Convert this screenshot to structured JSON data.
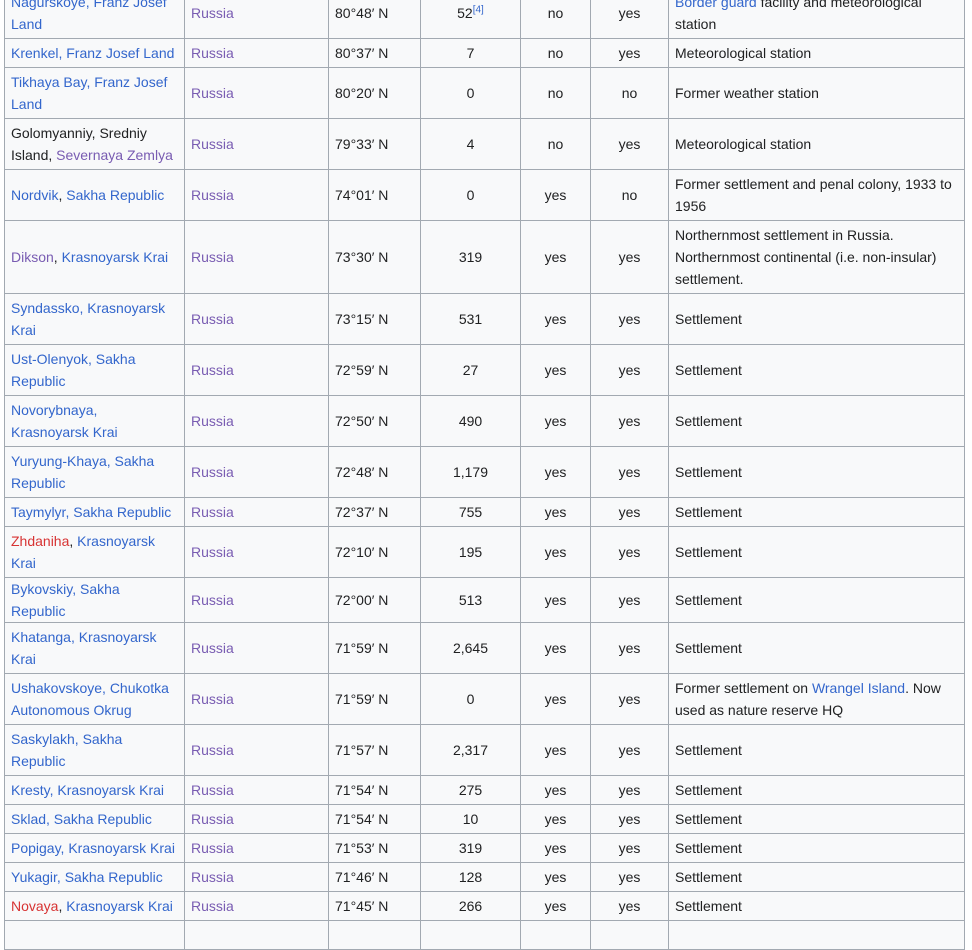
{
  "rows": [
    {
      "place": [
        {
          "t": "Nagurskoye, Franz Josef Land",
          "s": "link"
        }
      ],
      "country": "Russia",
      "lat": "80°48′ N",
      "pop": "52",
      "ref": "[4]",
      "y1": "no",
      "y2": "yes",
      "notes": [
        {
          "t": "Border guard",
          "s": "link"
        },
        {
          "t": " facility and meteorological station",
          "s": "plain"
        }
      ],
      "h": 51
    },
    {
      "place": [
        {
          "t": "Krenkel, Franz Josef Land",
          "s": "link"
        }
      ],
      "country": "Russia",
      "lat": "80°37′ N",
      "pop": "7",
      "y1": "no",
      "y2": "yes",
      "notes": [
        {
          "t": "Meteorological station",
          "s": "plain"
        }
      ],
      "h": 29
    },
    {
      "place": [
        {
          "t": "Tikhaya Bay, Franz Josef Land",
          "s": "link"
        }
      ],
      "country": "Russia",
      "lat": "80°20′ N",
      "pop": "0",
      "y1": "no",
      "y2": "no",
      "notes": [
        {
          "t": "Former weather station",
          "s": "plain"
        }
      ],
      "h": 51
    },
    {
      "place": [
        {
          "t": "Golomyanniy, Sredniy Island",
          "s": "plain"
        },
        {
          "t": ", ",
          "s": "plain"
        },
        {
          "t": "Severnaya Zemlya",
          "s": "visited"
        }
      ],
      "country": "Russia",
      "lat": "79°33′ N",
      "pop": "4",
      "y1": "no",
      "y2": "yes",
      "notes": [
        {
          "t": "Meteorological station",
          "s": "plain"
        }
      ],
      "h": 51
    },
    {
      "place": [
        {
          "t": "Nordvik",
          "s": "link"
        },
        {
          "t": ", ",
          "s": "plain"
        },
        {
          "t": "Sakha Republic",
          "s": "link"
        }
      ],
      "country": "Russia",
      "lat": "74°01′ N",
      "pop": "0",
      "y1": "yes",
      "y2": "no",
      "notes": [
        {
          "t": "Former settlement and penal colony, 1933 to 1956",
          "s": "plain"
        }
      ],
      "h": 51
    },
    {
      "place": [
        {
          "t": "Dikson",
          "s": "visited"
        },
        {
          "t": ", ",
          "s": "plain"
        },
        {
          "t": "Krasnoyarsk Krai",
          "s": "link"
        }
      ],
      "country": "Russia",
      "lat": "73°30′ N",
      "pop": "319",
      "y1": "yes",
      "y2": "yes",
      "notes": [
        {
          "t": "Northernmost settlement in Russia. Northernmost continental (i.e. non-insular) settlement.",
          "s": "plain"
        }
      ],
      "h": 73
    },
    {
      "place": [
        {
          "t": "Syndassko, Krasnoyarsk Krai",
          "s": "link"
        }
      ],
      "country": "Russia",
      "lat": "73°15′ N",
      "pop": "531",
      "y1": "yes",
      "y2": "yes",
      "notes": [
        {
          "t": "Settlement",
          "s": "plain"
        }
      ],
      "h": 51
    },
    {
      "place": [
        {
          "t": "Ust-Olenyok, Sakha Republic",
          "s": "link"
        }
      ],
      "country": "Russia",
      "lat": "72°59′ N",
      "pop": "27",
      "y1": "yes",
      "y2": "yes",
      "notes": [
        {
          "t": "Settlement",
          "s": "plain"
        }
      ],
      "h": 51
    },
    {
      "place": [
        {
          "t": "Novorybnaya, Krasnoyarsk Krai",
          "s": "link"
        }
      ],
      "country": "Russia",
      "lat": "72°50′ N",
      "pop": "490",
      "y1": "yes",
      "y2": "yes",
      "notes": [
        {
          "t": "Settlement",
          "s": "plain"
        }
      ],
      "h": 51
    },
    {
      "place": [
        {
          "t": "Yuryung-Khaya, Sakha Republic",
          "s": "link"
        }
      ],
      "country": "Russia",
      "lat": "72°48′ N",
      "pop": "1,179",
      "y1": "yes",
      "y2": "yes",
      "notes": [
        {
          "t": "Settlement",
          "s": "plain"
        }
      ],
      "h": 51
    },
    {
      "place": [
        {
          "t": "Taymylyr, Sakha Republic",
          "s": "link"
        }
      ],
      "country": "Russia",
      "lat": "72°37′ N",
      "pop": "755",
      "y1": "yes",
      "y2": "yes",
      "notes": [
        {
          "t": "Settlement",
          "s": "plain"
        }
      ],
      "h": 29
    },
    {
      "place": [
        {
          "t": "Zhdaniha",
          "s": "new"
        },
        {
          "t": ", ",
          "s": "plain"
        },
        {
          "t": "Krasnoyarsk Krai",
          "s": "link"
        }
      ],
      "country": "Russia",
      "lat": "72°10′ N",
      "pop": "195",
      "y1": "yes",
      "y2": "yes",
      "notes": [
        {
          "t": "Settlement",
          "s": "plain"
        }
      ],
      "h": 51
    },
    {
      "place": [
        {
          "t": "Bykovskiy, Sakha Republic",
          "s": "link"
        }
      ],
      "country": "Russia",
      "lat": "72°00′ N",
      "pop": "513",
      "y1": "yes",
      "y2": "yes",
      "notes": [
        {
          "t": "Settlement",
          "s": "plain"
        }
      ],
      "h": 29
    },
    {
      "place": [
        {
          "t": "Khatanga, Krasnoyarsk Krai",
          "s": "link"
        }
      ],
      "country": "Russia",
      "lat": "71°59′ N",
      "pop": "2,645",
      "y1": "yes",
      "y2": "yes",
      "notes": [
        {
          "t": "Settlement",
          "s": "plain"
        }
      ],
      "h": 51
    },
    {
      "place": [
        {
          "t": "Ushakovskoye, Chukotka Autonomous Okrug",
          "s": "link"
        }
      ],
      "country": "Russia",
      "lat": "71°59′ N",
      "pop": "0",
      "y1": "yes",
      "y2": "yes",
      "notes": [
        {
          "t": "Former settlement on ",
          "s": "plain"
        },
        {
          "t": "Wrangel Island",
          "s": "link"
        },
        {
          "t": ". Now used as nature reserve HQ",
          "s": "plain"
        }
      ],
      "h": 51
    },
    {
      "place": [
        {
          "t": "Saskylakh, Sakha Republic",
          "s": "link"
        }
      ],
      "country": "Russia",
      "lat": "71°57′ N",
      "pop": "2,317",
      "y1": "yes",
      "y2": "yes",
      "notes": [
        {
          "t": "Settlement",
          "s": "plain"
        }
      ],
      "h": 51
    },
    {
      "place": [
        {
          "t": "Kresty, Krasnoyarsk Krai",
          "s": "link"
        }
      ],
      "country": "Russia",
      "lat": "71°54′ N",
      "pop": "275",
      "y1": "yes",
      "y2": "yes",
      "notes": [
        {
          "t": "Settlement",
          "s": "plain"
        }
      ],
      "h": 29
    },
    {
      "place": [
        {
          "t": "Sklad, Sakha Republic",
          "s": "link"
        }
      ],
      "country": "Russia",
      "lat": "71°54′ N",
      "pop": "10",
      "y1": "yes",
      "y2": "yes",
      "notes": [
        {
          "t": "Settlement",
          "s": "plain"
        }
      ],
      "h": 29
    },
    {
      "place": [
        {
          "t": "Popigay, Krasnoyarsk Krai",
          "s": "link"
        }
      ],
      "country": "Russia",
      "lat": "71°53′ N",
      "pop": "319",
      "y1": "yes",
      "y2": "yes",
      "notes": [
        {
          "t": "Settlement",
          "s": "plain"
        }
      ],
      "h": 29
    },
    {
      "place": [
        {
          "t": "Yukagir, Sakha Republic",
          "s": "link"
        }
      ],
      "country": "Russia",
      "lat": "71°46′ N",
      "pop": "128",
      "y1": "yes",
      "y2": "yes",
      "notes": [
        {
          "t": "Settlement",
          "s": "plain"
        }
      ],
      "h": 29
    },
    {
      "place": [
        {
          "t": "Novaya",
          "s": "new"
        },
        {
          "t": ", ",
          "s": "plain"
        },
        {
          "t": "Krasnoyarsk Krai",
          "s": "link"
        }
      ],
      "country": "Russia",
      "lat": "71°45′ N",
      "pop": "266",
      "y1": "yes",
      "y2": "yes",
      "notes": [
        {
          "t": "Settlement",
          "s": "plain"
        }
      ],
      "h": 29
    },
    {
      "place": [
        {
          "t": "",
          "s": "plain"
        }
      ],
      "country": "",
      "lat": "",
      "pop": "",
      "y1": "",
      "y2": "",
      "notes": [
        {
          "t": "",
          "s": "plain"
        }
      ],
      "h": 29
    }
  ]
}
